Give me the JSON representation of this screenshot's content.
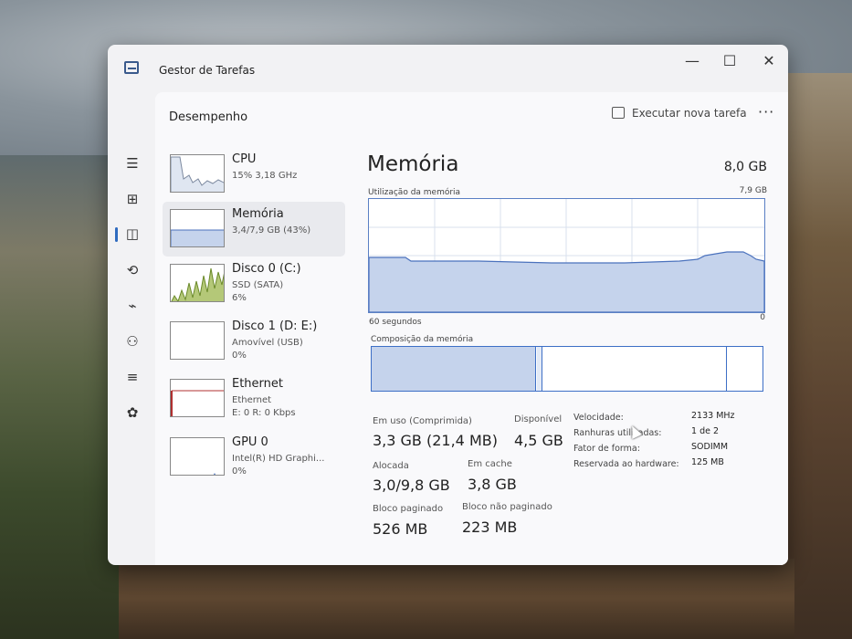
{
  "window": {
    "title": "Gestor de Tarefas"
  },
  "header": {
    "title": "Desempenho",
    "new_task_label": "Executar nova tarefa",
    "more_label": "···"
  },
  "window_controls": {
    "minimize": "—",
    "maximize": "☐",
    "close": "✕"
  },
  "nav": {
    "items": [
      {
        "icon": "hamburger-menu-icon",
        "glyph": "☰"
      },
      {
        "icon": "processes-icon",
        "glyph": "⊞"
      },
      {
        "icon": "performance-icon",
        "glyph": "◫"
      },
      {
        "icon": "app-history-icon",
        "glyph": "⟲"
      },
      {
        "icon": "startup-apps-icon",
        "glyph": "⌁"
      },
      {
        "icon": "users-icon",
        "glyph": "⚇"
      },
      {
        "icon": "details-icon",
        "glyph": "≡"
      },
      {
        "icon": "services-icon",
        "glyph": "✿"
      },
      {
        "icon": "settings-icon",
        "glyph": "⚙"
      }
    ]
  },
  "devices": [
    {
      "name": "CPU",
      "sub1": "15% 3,18 GHz",
      "sub2": ""
    },
    {
      "name": "Memória",
      "sub1": "3,4/7,9 GB (43%)",
      "sub2": ""
    },
    {
      "name": "Disco 0 (C:)",
      "sub1": "SSD (SATA)",
      "sub2": "6%"
    },
    {
      "name": "Disco 1 (D: E:)",
      "sub1": "Amovível (USB)",
      "sub2": "0%"
    },
    {
      "name": "Ethernet",
      "sub1": "Ethernet",
      "sub2": "E: 0 R: 0 Kbps"
    },
    {
      "name": "GPU 0",
      "sub1": "Intel(R) HD Graphi...",
      "sub2": "0%"
    }
  ],
  "detail": {
    "title": "Memória",
    "total": "8,0 GB",
    "usage_graph_label": "Utilização da memória",
    "usage_graph_max": "7,9 GB",
    "time_label": "60 segundos",
    "zero_label": "0",
    "composition_label": "Composição da memória",
    "stats": {
      "in_use_label": "Em uso (Comprimida)",
      "in_use_value": "3,3 GB (21,4 MB)",
      "available_label": "Disponível",
      "available_value": "4,5 GB",
      "committed_label": "Alocada",
      "committed_value": "3,0/9,8 GB",
      "cached_label": "Em cache",
      "cached_value": "3,8 GB",
      "paged_label": "Bloco paginado",
      "paged_value": "526 MB",
      "nonpaged_label": "Bloco não paginado",
      "nonpaged_value": "223 MB"
    },
    "specs": [
      {
        "key": "Velocidade:",
        "value": "2133 MHz"
      },
      {
        "key": "Ranhuras utilizadas:",
        "value": "1 de 2"
      },
      {
        "key": "Fator de forma:",
        "value": "SODIMM"
      },
      {
        "key": "Reservada ao hardware:",
        "value": "125 MB"
      }
    ]
  },
  "colors": {
    "accent": "#2f6bbf",
    "memory_fill": "#c5d3ec",
    "disk_fill": "#9fb85a",
    "ethernet_line": "#b03030"
  }
}
